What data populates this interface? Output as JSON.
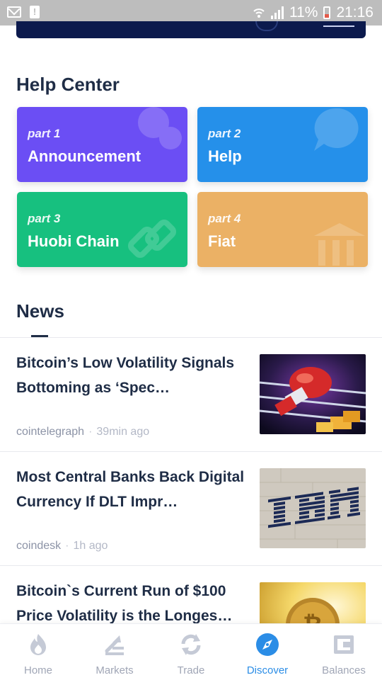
{
  "status_bar": {
    "battery": "11%",
    "time": "21:16",
    "icons": [
      "mail-icon",
      "alert-icon",
      "wifi-icon",
      "signal-icon",
      "battery-icon"
    ]
  },
  "help_center": {
    "title": "Help Center",
    "cards": [
      {
        "part": "part 1",
        "label": "Announcement",
        "color": "#6b4ef4",
        "icon": "chat-bubbles-icon"
      },
      {
        "part": "part 2",
        "label": "Help",
        "color": "#2590ea",
        "icon": "question-bubble-icon"
      },
      {
        "part": "part 3",
        "label": "Huobi Chain",
        "color": "#17c07f",
        "icon": "chain-link-icon"
      },
      {
        "part": "part 4",
        "label": "Fiat",
        "color": "#ebb165",
        "icon": "bank-icon"
      }
    ]
  },
  "news": {
    "title": "News",
    "items": [
      {
        "headline": "Bitcoin’s Low Volatility Signals Bottoming as ‘Spec…",
        "source": "cointelegraph",
        "time": "39min ago",
        "image": "boxing-glove-image"
      },
      {
        "headline": "Most Central Banks Back Digital Currency If DLT Impr…",
        "source": "coindesk",
        "time": "1h ago",
        "image": "ibm-logo-wall-image"
      },
      {
        "headline": "Bitcoin`s Current Run of $100 Price Volatility is the Longes…",
        "source": "",
        "time": "",
        "image": "bitcoin-coin-image"
      }
    ]
  },
  "bottom_nav": {
    "items": [
      {
        "label": "Home",
        "icon": "flame-icon"
      },
      {
        "label": "Markets",
        "icon": "markets-icon"
      },
      {
        "label": "Trade",
        "icon": "trade-arrows-icon"
      },
      {
        "label": "Discover",
        "icon": "compass-icon",
        "active": true
      },
      {
        "label": "Balances",
        "icon": "wallet-icon"
      }
    ],
    "active_color": "#2b8de6",
    "inactive_color": "#a0a6b6"
  }
}
